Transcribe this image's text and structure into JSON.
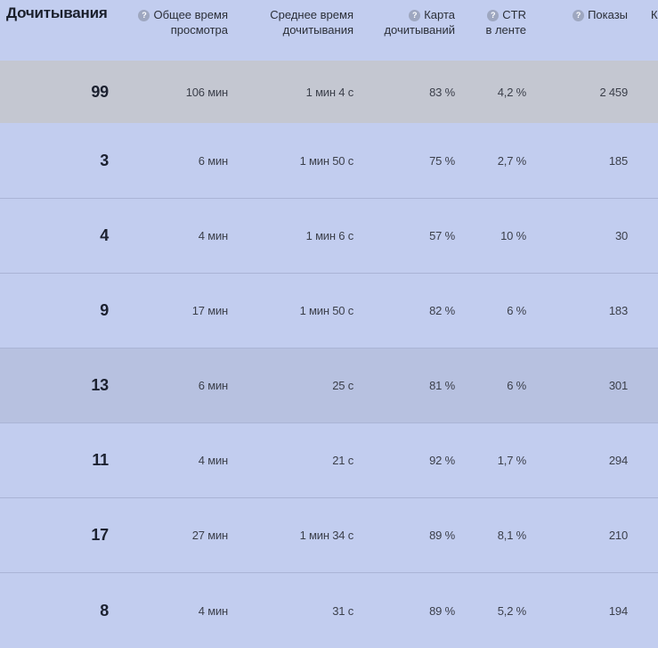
{
  "header": {
    "first": "Дочитывания",
    "col1": [
      "Общее время",
      "просмотра"
    ],
    "col2": [
      "Среднее время",
      "дочитывания"
    ],
    "col3": [
      "Карта",
      "дочитываний"
    ],
    "col4": [
      "CTR",
      "в ленте"
    ],
    "col5": "Показы",
    "col6_partial": "К",
    "help_glyph": "?"
  },
  "rows": [
    {
      "reads": "99",
      "total_time": "106 мин",
      "avg_time": "1 мин 4 с",
      "map": "83 %",
      "ctr": "4,2 %",
      "views": "2 459"
    },
    {
      "reads": "3",
      "total_time": "6 мин",
      "avg_time": "1 мин 50 с",
      "map": "75 %",
      "ctr": "2,7 %",
      "views": "185"
    },
    {
      "reads": "4",
      "total_time": "4 мин",
      "avg_time": "1 мин 6 с",
      "map": "57 %",
      "ctr": "10 %",
      "views": "30"
    },
    {
      "reads": "9",
      "total_time": "17 мин",
      "avg_time": "1 мин 50 с",
      "map": "82 %",
      "ctr": "6 %",
      "views": "183"
    },
    {
      "reads": "13",
      "total_time": "6 мин",
      "avg_time": "25 с",
      "map": "81 %",
      "ctr": "6 %",
      "views": "301"
    },
    {
      "reads": "11",
      "total_time": "4 мин",
      "avg_time": "21 с",
      "map": "92 %",
      "ctr": "1,7 %",
      "views": "294"
    },
    {
      "reads": "17",
      "total_time": "27 мин",
      "avg_time": "1 мин 34 с",
      "map": "89 %",
      "ctr": "8,1 %",
      "views": "210"
    },
    {
      "reads": "8",
      "total_time": "4 мин",
      "avg_time": "31 с",
      "map": "89 %",
      "ctr": "5,2 %",
      "views": "194"
    }
  ]
}
